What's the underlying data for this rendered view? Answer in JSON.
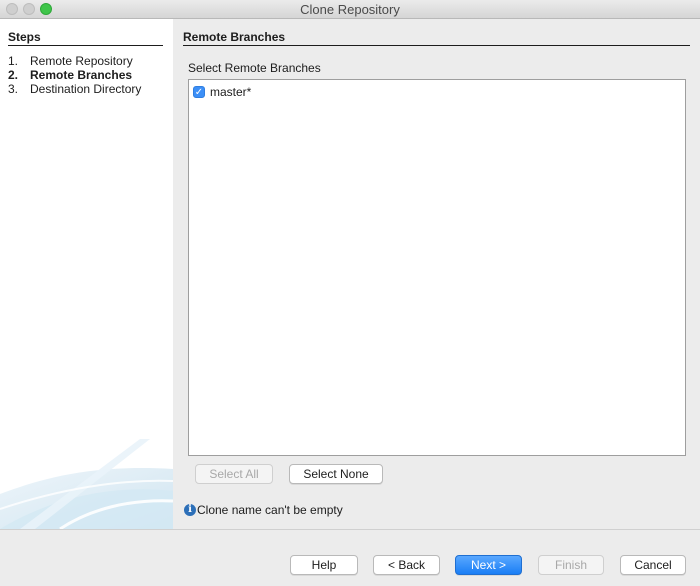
{
  "window": {
    "title": "Clone Repository"
  },
  "steps": {
    "heading": "Steps",
    "items": [
      {
        "num": "1.",
        "label": "Remote Repository"
      },
      {
        "num": "2.",
        "label": "Remote Branches"
      },
      {
        "num": "3.",
        "label": "Destination Directory"
      }
    ],
    "active_index": 1
  },
  "main": {
    "heading": "Remote Branches",
    "list_label": "Select Remote Branches",
    "branches": [
      {
        "name": "master*",
        "checked": true
      }
    ],
    "select_all_label": "Select All",
    "select_none_label": "Select None",
    "info_icon": "info-icon",
    "info_message": "Clone name can't be empty"
  },
  "footer": {
    "help_label": "Help",
    "back_label": "< Back",
    "next_label": "Next >",
    "finish_label": "Finish",
    "cancel_label": "Cancel"
  },
  "colors": {
    "accent": "#1a7ef5",
    "checkbox": "#3c8ff7",
    "window_bg": "#ececec"
  }
}
